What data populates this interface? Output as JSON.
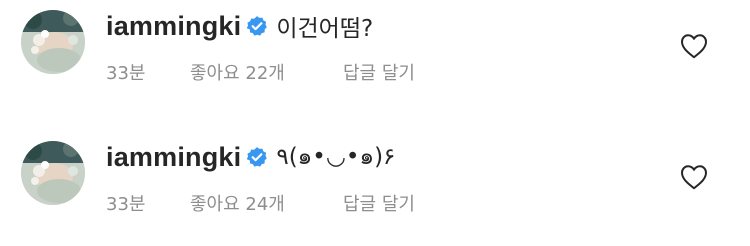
{
  "comments": [
    {
      "username": "iammingki",
      "text": "이건어떰?",
      "time": "33분",
      "likes": "좋아요 22개",
      "reply": "답글 달기",
      "verified_icon": "verified-badge-icon",
      "like_icon": "heart-outline-icon"
    },
    {
      "username": "iammingki",
      "text": "٩(๑•◡•๑)۶",
      "time": "33분",
      "likes": "좋아요 24개",
      "reply": "답글 달기",
      "verified_icon": "verified-badge-icon",
      "like_icon": "heart-outline-icon"
    }
  ],
  "colors": {
    "text_primary": "#262626",
    "text_secondary": "#8e8e8e",
    "verified_blue": "#3897f0",
    "background": "#ffffff"
  }
}
